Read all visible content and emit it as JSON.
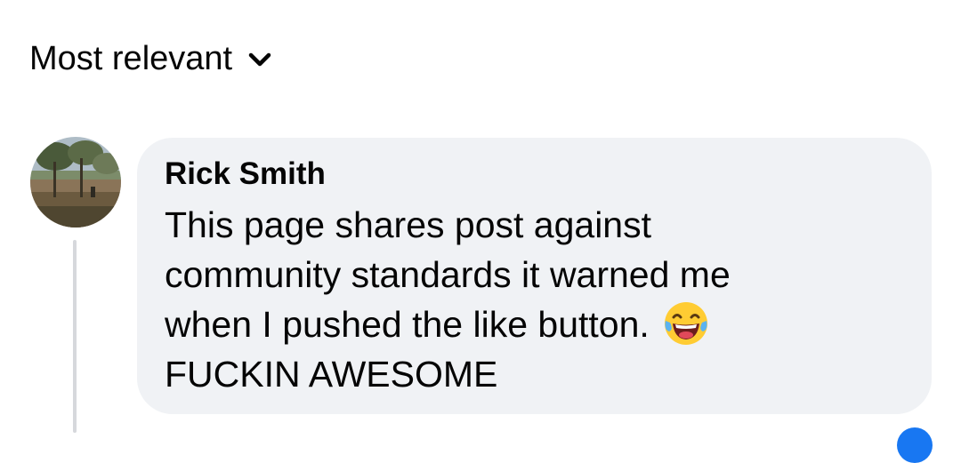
{
  "sort": {
    "label": "Most relevant",
    "icon": "chevron-down-icon"
  },
  "comment": {
    "author": "Rick Smith",
    "lines": [
      "This page shares post against",
      "community standards it warned me",
      "when I pushed the like button.",
      "FUCKIN AWESOME"
    ],
    "emoji": "tears-of-joy-emoji"
  },
  "colors": {
    "bubble_bg": "#f0f2f5",
    "text": "#050505",
    "thread_line": "#d6d8dc",
    "reaction_blue": "#1877f2"
  }
}
